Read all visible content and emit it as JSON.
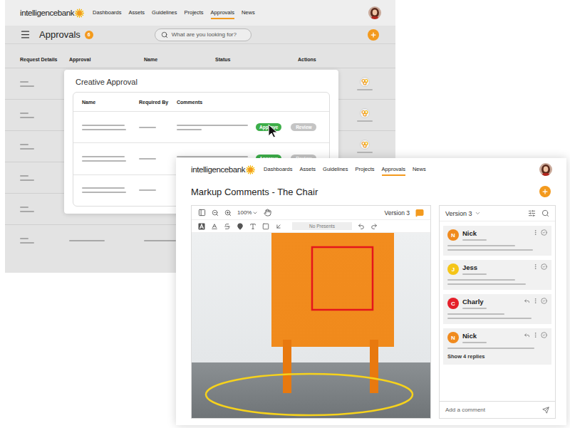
{
  "back_window": {
    "logo": "intelligencebank",
    "nav": [
      {
        "label": "Dashboards",
        "selected": false
      },
      {
        "label": "Assets",
        "selected": false
      },
      {
        "label": "Guidelines",
        "selected": false
      },
      {
        "label": "Projects",
        "selected": false
      },
      {
        "label": "Approvals",
        "selected": true
      },
      {
        "label": "News",
        "selected": false
      }
    ],
    "page_title": "Approvals",
    "count_badge": "6",
    "search": {
      "placeholder": "What are you looking for?"
    },
    "table": {
      "columns": [
        "Request Details",
        "Approval",
        "Name",
        "Status",
        "Actions"
      ],
      "rows": [
        {
          "has_action": true
        },
        {
          "has_action": true
        },
        {
          "has_action": true
        },
        {
          "has_action": true
        },
        {
          "has_action": true
        },
        {
          "has_action": true
        }
      ]
    }
  },
  "approval_modal": {
    "title": "Creative Approval",
    "columns": [
      "Name",
      "Required By",
      "Comments"
    ],
    "rows": [
      {
        "buttons": [
          {
            "label": "Approve",
            "color": "#3dae49"
          },
          {
            "label": "Review",
            "color": "#c4c4c4"
          }
        ]
      },
      {
        "buttons": [
          {
            "label": "Approve",
            "color": "#3dae49"
          },
          {
            "label": "Review",
            "color": "#c4c4c4"
          }
        ]
      },
      {
        "buttons": []
      }
    ]
  },
  "front_window": {
    "logo": "intelligencebank",
    "nav": [
      {
        "label": "Dashboards",
        "selected": false
      },
      {
        "label": "Assets",
        "selected": false
      },
      {
        "label": "Guidelines",
        "selected": false
      },
      {
        "label": "Projects",
        "selected": false
      },
      {
        "label": "Approvals",
        "selected": true
      },
      {
        "label": "News",
        "selected": false
      }
    ],
    "title": "Markup Comments - The Chair",
    "viewer": {
      "zoom": "100%",
      "version": "Version 3",
      "presets": "No Presents"
    },
    "comments_panel": {
      "version": "Version 3",
      "comments": [
        {
          "name": "Nick",
          "initial": "N",
          "color": "#f08a1e",
          "has_reply": false
        },
        {
          "name": "Jess",
          "initial": "J",
          "color": "#f5c518",
          "has_reply": false
        },
        {
          "name": "Charly",
          "initial": "C",
          "color": "#e41f2a",
          "has_reply": true
        },
        {
          "name": "Nick",
          "initial": "N",
          "color": "#f08a1e",
          "has_reply": true,
          "replies": "Show 4 replies"
        }
      ],
      "input_placeholder": "Add a comment"
    }
  }
}
